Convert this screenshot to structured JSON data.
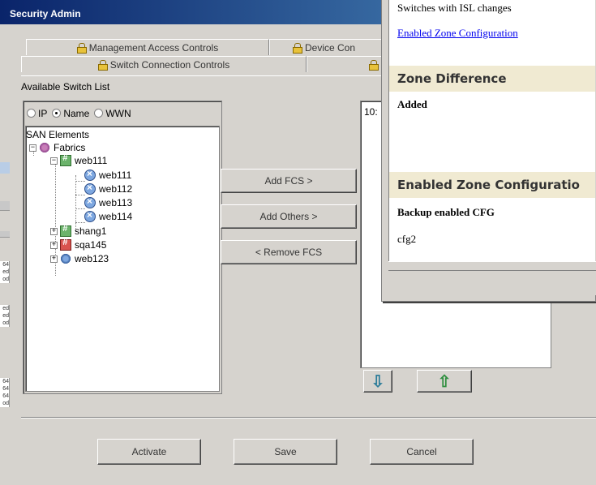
{
  "window": {
    "title": "Security Admin"
  },
  "tabs": {
    "row1": [
      {
        "label": "Management Access Controls"
      },
      {
        "label": "Device Con"
      }
    ],
    "row2": [
      {
        "label": "Switch Connection Controls"
      }
    ]
  },
  "available_list": {
    "label": "Available Switch List",
    "radios": [
      {
        "label": "IP",
        "checked": false
      },
      {
        "label": "Name",
        "checked": true
      },
      {
        "label": "WWN",
        "checked": false
      }
    ],
    "tree": {
      "root": "SAN Elements",
      "fabrics_label": "Fabrics",
      "groups": [
        {
          "label": "web111",
          "expanded": true,
          "children": [
            "web111",
            "web112",
            "web113",
            "web114"
          ]
        },
        {
          "label": "shang1",
          "expanded": false,
          "icon": "switch-group-icon"
        },
        {
          "label": "sqa145",
          "expanded": false,
          "icon": "fabric-icon"
        },
        {
          "label": "web123",
          "expanded": false,
          "icon": "fabric-icon"
        }
      ]
    }
  },
  "actions": {
    "add_fcs": "Add FCS >",
    "add_others": "Add Others >",
    "remove_fcs": "< Remove FCS"
  },
  "fcs_list": {
    "first_item": "10:"
  },
  "footer": {
    "activate": "Activate",
    "save": "Save",
    "cancel": "Cancel"
  },
  "report": {
    "line1": "Switches with ISL changes",
    "link": "Enabled Zone Configuration",
    "section1": "Zone Difference",
    "added": "Added",
    "section2": "Enabled Zone Configuratio",
    "backup_label": "Backup enabled CFG",
    "cfg_value": "cfg2"
  },
  "background": {
    "rows": [
      "64",
      "ed",
      "od",
      "ed",
      "ed",
      "od",
      "64",
      "64",
      "64",
      "od"
    ]
  },
  "colors": {
    "title_bar": "#0a246a",
    "section_bg": "#f0ead2",
    "link": "#0000ee"
  }
}
